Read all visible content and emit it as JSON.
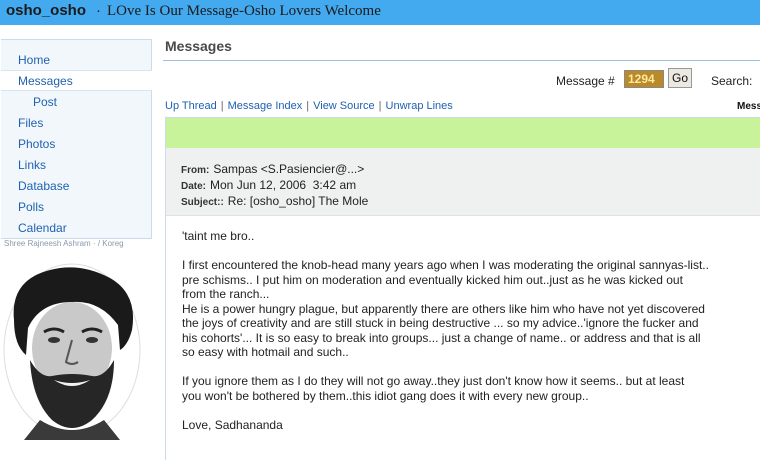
{
  "header": {
    "group_name": "osho_osho",
    "separator": "·",
    "description": "LOve Is Our Message-Osho Lovers Welcome"
  },
  "nav": {
    "items": [
      {
        "label": "Home"
      },
      {
        "label": "Messages",
        "selected": true
      },
      {
        "label": "Post",
        "sub": true
      },
      {
        "label": "Files"
      },
      {
        "label": "Photos"
      },
      {
        "label": "Links"
      },
      {
        "label": "Database"
      },
      {
        "label": "Polls"
      },
      {
        "label": "Calendar"
      }
    ],
    "photo_caption": "Shree Rajneesh Ashram · / Koreg"
  },
  "main": {
    "title": "Messages",
    "message_number_label": "Message #",
    "message_number_value": "1294",
    "go_label": "Go",
    "search_label": "Search:",
    "thread_links": [
      "Up Thread",
      "Message Index",
      "View Source",
      "Unwrap Lines"
    ],
    "thread_links_cut": "Mess"
  },
  "message": {
    "from_label": "From:",
    "from_value": "Sampas <S.Pasiencier@...>",
    "date_label": "Date:",
    "date_value": "Mon Jun 12, 2006  3:42 am",
    "subject_label": "Subject::",
    "subject_value": "Re: [osho_osho] The Mole",
    "paragraphs": [
      "'taint me bro..",
      "I first encountered the knob-head many years ago when I was moderating the original sannyas-list..\npre schisms.. I put him on moderation and eventually kicked him out..just as he was kicked out\nfrom the ranch...\nHe is a power hungry plague, but apparently there are others like him who have not yet discovered\nthe joys of creativity and are still stuck in being destructive ... so my advice..'ignore the fucker and\nhis cohorts'... It is so easy to break into groups... just a change of name.. or address and that is all\nso easy with hotmail and such..",
      "If you ignore them as I do they will not go away..they just don't know how it seems.. but at least\nyou won't be bothered by them..this idiot gang does it with every new group..",
      "Love, Sadhananda"
    ]
  },
  "colors": {
    "header_bg": "#44aaf0",
    "link": "#1f61b0",
    "green_bar": "#c8f39a",
    "nav_bg": "#f2f7fc"
  }
}
